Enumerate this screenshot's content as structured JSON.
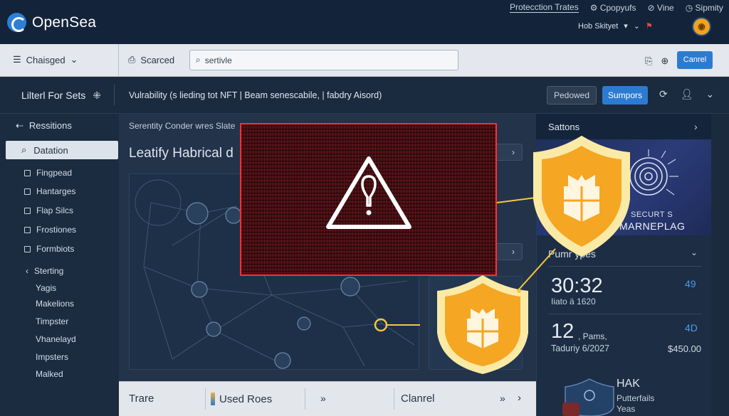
{
  "app": {
    "name": "OpenSea"
  },
  "topnav": {
    "items": [
      "Protecction Trates",
      "Cpopyufs",
      "Vine",
      "Sipmity"
    ]
  },
  "topright": {
    "label": "Hob Skityet"
  },
  "toolbar": {
    "changed_label": "Chaisged",
    "scarced_label": "Scarced",
    "search_value": "sertivle",
    "cancel_label": "Canrel"
  },
  "subheader": {
    "title": "Lilterl For Sets",
    "description": "Vulrability (s lieding tot NFT | Beam senescabile, | fabdry Aisord)",
    "pedowed_label": "Pedowed",
    "sumpors_label": "Sumpors"
  },
  "sidebar": {
    "back_label": "Ressitions",
    "active_label": "Datation",
    "items": [
      "Fingpead",
      "Hantarges",
      "Flap Silcs",
      "Frostiones",
      "Formbiots"
    ],
    "section_label": "Sterting",
    "sub_items": [
      "Yagis",
      "Makelions",
      "Timpster",
      "Vhanelayd",
      "Impsters",
      "Malked"
    ]
  },
  "main": {
    "hint": "Serentity Conder wres Slate",
    "title": "Leatify Habrical d"
  },
  "right_panel": {
    "header": "Sattons",
    "banner_line1": "SECURT S",
    "banner_line2": "MARNEPLAG",
    "section": "Pumr  ypes",
    "metric1": {
      "value": "30:32",
      "sub": "Iiato ä 1620",
      "stat": "49"
    },
    "metric2": {
      "value": "12",
      "tail": ", Pams,",
      "sub": "Taduriy 6/2027",
      "stat": "4D",
      "amount": "$450.00"
    },
    "hak": {
      "title": "HAK",
      "line1": "Putterfails",
      "line2": "Yeas"
    }
  },
  "bottombar": {
    "trare_label": "Trare",
    "used_label": "Used Roes",
    "clanrel_label": "Clanrel"
  },
  "colors": {
    "accent": "#2d7bd1",
    "alert": "#ff2d2d",
    "shield": "#f5a623",
    "link": "#4d9be8"
  },
  "icons": [
    "opensea-logo-icon",
    "warning-icon",
    "shield-icon",
    "search-icon",
    "menu-icon",
    "user-icon"
  ]
}
